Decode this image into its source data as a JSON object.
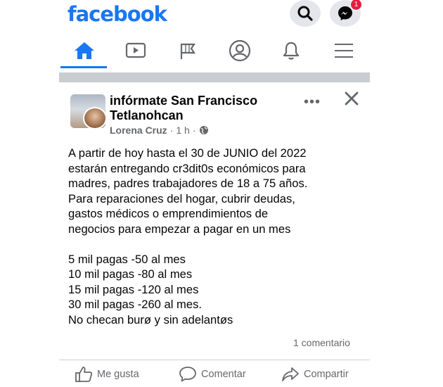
{
  "header": {
    "brand": "facebook",
    "messenger_badge": "1"
  },
  "nav": {
    "items": [
      "home",
      "watch",
      "pages",
      "profile",
      "notifications",
      "menu"
    ],
    "active": "home"
  },
  "post": {
    "page_name": "infórmate San Francisco Tetlanohcan",
    "author": "Lorena Cruz",
    "separator": "·",
    "time": "1 h",
    "privacy": "public",
    "body_lines": [
      "A partir de hoy hasta el 30 de JUNIO del 2022",
      "estarán entregando  cr3dit0s económicos para",
      "madres, padres trabajadores de 18 a 75 años.",
      "Para reparaciones del hogar, cubrir deudas,",
      "gastos médicos o emprendimientos de",
      "negocios para empezar a pagar en un mes"
    ],
    "list_lines": [
      "5 mil pagas -50 al mes",
      "10 mil pagas -80 al mes",
      "15 mil pagas -120 al mes",
      "30 mil pagas -260 al mes.",
      "No checan burø y sin adelantøs"
    ],
    "comments_count": "1 comentario",
    "actions": {
      "like": "Me gusta",
      "comment": "Comentar",
      "share": "Compartir"
    }
  },
  "colors": {
    "brand_blue": "#1877f2",
    "badge_red": "#e41e3f",
    "secondary_text": "#65676b"
  }
}
